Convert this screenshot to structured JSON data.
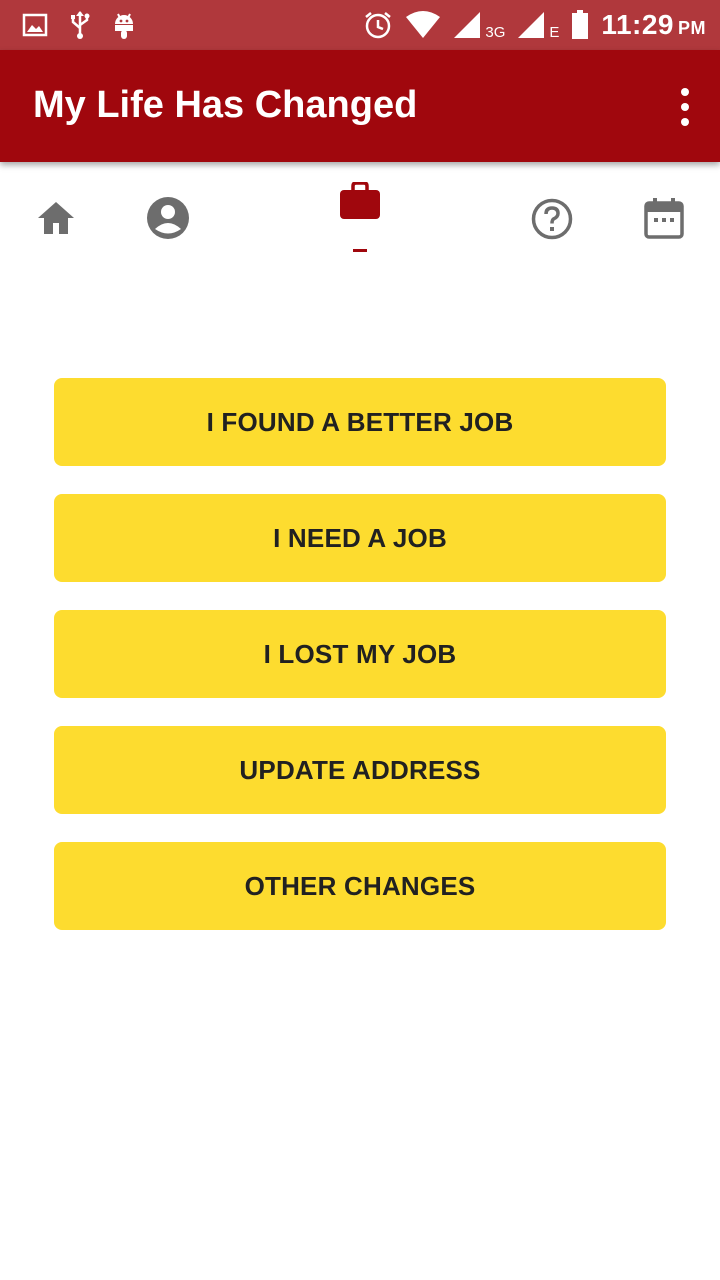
{
  "status_bar": {
    "time": "11:29",
    "ampm": "PM",
    "network_3g": "3G",
    "network_e": "E",
    "icons": [
      "image-icon",
      "usb-icon",
      "android-icon",
      "alarm-icon",
      "wifi-icon",
      "signal-icon",
      "battery-icon"
    ]
  },
  "app_bar": {
    "title": "My Life Has Changed",
    "overflow_icon": "more-vert-icon"
  },
  "tabs": [
    {
      "icon": "home-icon",
      "selected": false
    },
    {
      "icon": "account-icon",
      "selected": false
    },
    {
      "icon": "briefcase-icon",
      "selected": true
    },
    {
      "icon": "help-icon",
      "selected": false
    },
    {
      "icon": "calendar-icon",
      "selected": false
    }
  ],
  "actions": [
    {
      "label": "I FOUND A BETTER JOB"
    },
    {
      "label": "I NEED A JOB"
    },
    {
      "label": "I LOST MY JOB"
    },
    {
      "label": "UPDATE ADDRESS"
    },
    {
      "label": "OTHER CHANGES"
    }
  ],
  "colors": {
    "status_bar": "#b0383c",
    "app_bar": "#a0070d",
    "accent": "#a0070d",
    "button": "#fddc2f",
    "icon_inactive": "#6d6d6d"
  }
}
